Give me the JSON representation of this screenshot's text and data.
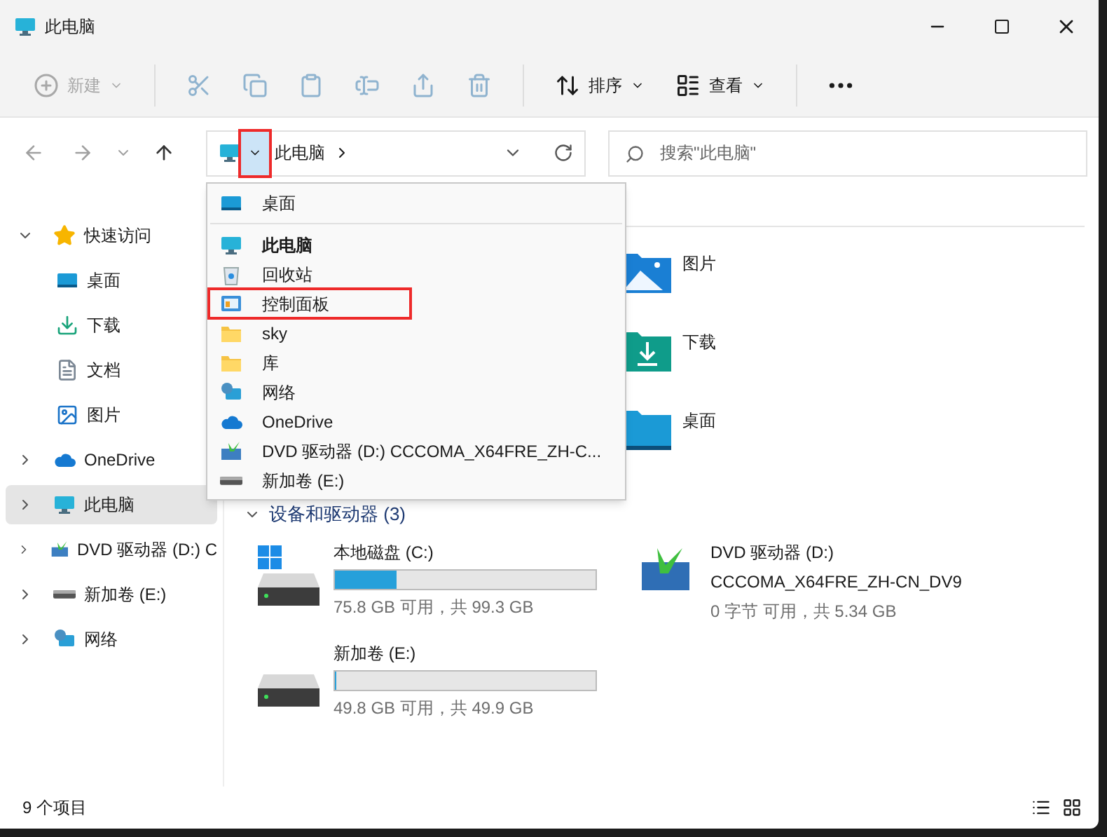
{
  "window": {
    "title": "此电脑"
  },
  "toolbar": [
    {
      "kind": "new",
      "label": "新建",
      "disabled": true
    },
    {
      "kind": "cut",
      "disabled": true
    },
    {
      "kind": "copy",
      "disabled": true
    },
    {
      "kind": "paste",
      "disabled": true
    },
    {
      "kind": "rename",
      "disabled": true
    },
    {
      "kind": "share",
      "disabled": true
    },
    {
      "kind": "delete",
      "disabled": true
    },
    {
      "kind": "sort",
      "label": "排序",
      "disabled": false
    },
    {
      "kind": "view",
      "label": "查看",
      "disabled": false
    },
    {
      "kind": "more",
      "disabled": false
    }
  ],
  "navigation": [
    {
      "kind": "back",
      "disabled": true
    },
    {
      "kind": "forward",
      "disabled": true
    },
    {
      "kind": "recent",
      "disabled": true
    },
    {
      "kind": "up",
      "disabled": false
    }
  ],
  "address_bar": {
    "location": "此电脑",
    "dropdown_highlighted": true
  },
  "search": {
    "placeholder": "搜索\"此电脑\""
  },
  "sidebar": {
    "items": [
      {
        "label": "快速访问",
        "kind": "star",
        "expanded": true,
        "selected": false,
        "children": [
          {
            "label": "桌面",
            "kind": "desktop",
            "selected": false
          },
          {
            "label": "下载",
            "kind": "download",
            "selected": false
          },
          {
            "label": "文档",
            "kind": "document",
            "selected": false
          },
          {
            "label": "图片",
            "kind": "pictures",
            "selected": false
          }
        ]
      },
      {
        "label": "OneDrive",
        "kind": "cloud",
        "expanded": false,
        "selected": false
      },
      {
        "label": "此电脑",
        "kind": "pc",
        "expanded": false,
        "selected": true
      },
      {
        "label": "DVD 驱动器 (D:) C",
        "kind": "dvd",
        "expanded": false,
        "selected": false
      },
      {
        "label": "新加卷 (E:)",
        "kind": "disk",
        "expanded": false,
        "selected": false
      },
      {
        "label": "网络",
        "kind": "network",
        "expanded": false,
        "selected": false
      }
    ]
  },
  "location_menu": {
    "groups": [
      [
        {
          "label": "桌面",
          "kind": "desktop",
          "bold": false,
          "highlighted": false
        }
      ],
      [
        {
          "label": "此电脑",
          "kind": "pc",
          "bold": true,
          "highlighted": false
        },
        {
          "label": "回收站",
          "kind": "recycle",
          "bold": false,
          "highlighted": false
        },
        {
          "label": "控制面板",
          "kind": "control",
          "bold": false,
          "highlighted": true
        },
        {
          "label": "sky",
          "kind": "folder",
          "bold": false,
          "highlighted": false
        },
        {
          "label": "库",
          "kind": "folder",
          "bold": false,
          "highlighted": false
        },
        {
          "label": "网络",
          "kind": "network",
          "bold": false,
          "highlighted": false
        },
        {
          "label": "OneDrive",
          "kind": "cloud",
          "bold": false,
          "highlighted": false
        },
        {
          "label": "DVD 驱动器 (D:) CCCOMA_X64FRE_ZH-C...",
          "kind": "dvd",
          "bold": false,
          "highlighted": false
        },
        {
          "label": "新加卷 (E:)",
          "kind": "disk",
          "bold": false,
          "highlighted": false
        }
      ]
    ]
  },
  "folders": [
    {
      "name": "图片",
      "kind": "pictures"
    },
    {
      "name": "下载",
      "kind": "download"
    },
    {
      "name": "桌面",
      "kind": "desktop"
    }
  ],
  "drives_section": {
    "title": "设备和驱动器 (3)",
    "expanded": true,
    "drives": [
      {
        "name": "本地磁盘 (C:)",
        "kind": "system",
        "level": 0.237,
        "space": "75.8 GB 可用，共 99.3 GB"
      },
      {
        "name": "DVD 驱动器 (D:)",
        "kind": "dvd",
        "volume": "CCCOMA_X64FRE_ZH-CN_DV9",
        "space": "0 字节 可用，共 5.34 GB"
      },
      {
        "name": "新加卷 (E:)",
        "kind": "disk",
        "level": 0.003,
        "space": "49.8 GB 可用，共 49.9 GB"
      }
    ]
  },
  "status_bar": {
    "item_count": "9 个项目"
  }
}
